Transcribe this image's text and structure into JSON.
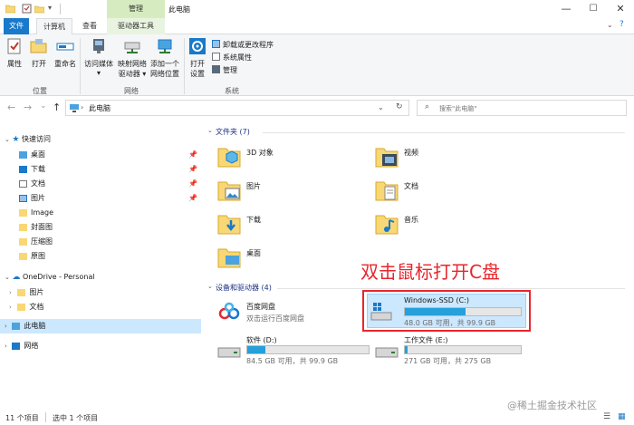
{
  "titlebar": {
    "title": "此电脑",
    "context_header": "管理",
    "minimize": "—",
    "maximize": "☐",
    "close": "✕"
  },
  "ribbon_tabs": {
    "file": "文件",
    "computer": "计算机",
    "view": "查看",
    "drive_tools": "驱动器工具"
  },
  "ribbon": {
    "location_group": "位置",
    "network_group": "网络",
    "system_group": "系统",
    "properties": "属性",
    "open": "打开",
    "rename": "重命名",
    "access_media_1": "访问媒体",
    "access_media_2": "▾",
    "map_drive_1": "映射网络",
    "map_drive_2": "驱动器 ▾",
    "add_location_1": "添加一个",
    "add_location_2": "网络位置",
    "open_settings_1": "打开",
    "open_settings_2": "设置",
    "uninstall": "卸载或更改程序",
    "system_props": "系统属性",
    "manage": "管理"
  },
  "nav": {
    "back": "←",
    "forward": "→",
    "recent": "⌄",
    "up": "↑",
    "address": "此电脑",
    "search_placeholder": "搜索\"此电脑\""
  },
  "sidebar": {
    "quick_access": "快速访问",
    "items": [
      {
        "label": "桌面",
        "pinned": true
      },
      {
        "label": "下载",
        "pinned": true
      },
      {
        "label": "文档",
        "pinned": true
      },
      {
        "label": "图片",
        "pinned": true
      },
      {
        "label": "Image"
      },
      {
        "label": "封面图"
      },
      {
        "label": "压缩图"
      },
      {
        "label": "原图"
      }
    ],
    "onedrive": "OneDrive - Personal",
    "onedrive_items": [
      {
        "label": "图片"
      },
      {
        "label": "文档"
      }
    ],
    "this_pc": "此电脑",
    "network": "网络"
  },
  "main": {
    "folders_header": "文件夹 (7)",
    "folders": [
      {
        "name": "3D 对象",
        "icon": "3d-objects-folder-icon"
      },
      {
        "name": "视频",
        "icon": "videos-folder-icon"
      },
      {
        "name": "图片",
        "icon": "pictures-folder-icon"
      },
      {
        "name": "文档",
        "icon": "documents-folder-icon"
      },
      {
        "name": "下载",
        "icon": "downloads-folder-icon"
      },
      {
        "name": "音乐",
        "icon": "music-folder-icon"
      },
      {
        "name": "桌面",
        "icon": "desktop-folder-icon"
      }
    ],
    "devices_header": "设备和驱动器 (4)",
    "baidu": {
      "name": "百度网盘",
      "subtitle": "双击运行百度网盘"
    },
    "drives": [
      {
        "name": "Windows-SSD (C:)",
        "free": "48.0 GB 可用，共 99.9 GB",
        "used_fraction": 0.52
      },
      {
        "name": "软件 (D:)",
        "free": "84.5 GB 可用，共 99.9 GB",
        "used_fraction": 0.15
      },
      {
        "name": "工作文件 (E:)",
        "free": "271 GB 可用，共 275 GB",
        "used_fraction": 0.02
      }
    ],
    "annotation": "双击鼠标打开C盘"
  },
  "status": {
    "count": "11 个项目",
    "selected": "选中 1 个项目"
  },
  "watermark": "@稀土掘金技术社区",
  "colors": {
    "accent": "#1979ca",
    "selection": "#cce8ff",
    "annotation": "#e8262d",
    "folder": "#f8d775",
    "bar_fill": "#26a0da"
  }
}
